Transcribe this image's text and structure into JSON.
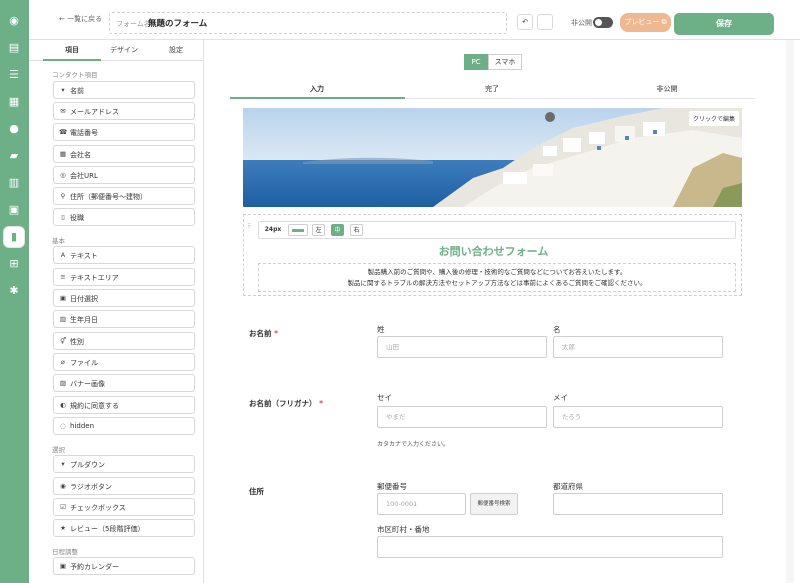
{
  "topbar": {
    "back_label": "← 一覧に戻る",
    "form_name_label": "フォーム名",
    "form_name_value": "無題のフォーム",
    "publish_label": "非公開",
    "preview_label": "プレビュー ⧉",
    "save_label": "保存"
  },
  "panel": {
    "tabs": [
      "項目",
      "デザイン",
      "設定"
    ],
    "sections": {
      "contact": "コンタクト項目",
      "basic": "基本",
      "choice": "選択",
      "schedule": "日程調整"
    },
    "contact_items": [
      "名前",
      "メールアドレス",
      "電話番号",
      "会社名",
      "会社URL",
      "住所（郵便番号〜建物）",
      "役職"
    ],
    "basic_items": [
      "テキスト",
      "テキストエリア",
      "日付選択",
      "生年月日",
      "性別",
      "ファイル",
      "バナー画像",
      "規約に同意する",
      "hidden"
    ],
    "choice_items": [
      "プルダウン",
      "ラジオボタン",
      "チェックボックス",
      "レビュー（5段階評価）"
    ],
    "schedule_items": [
      "予約カレンダー"
    ]
  },
  "canvas": {
    "device": {
      "pc": "PC",
      "sp": "スマホ"
    },
    "page_tabs": [
      "入力",
      "完了",
      "非公開"
    ],
    "hero_edit_label": "クリックで編集",
    "toolbar": {
      "size": "24px",
      "left": "左",
      "center": "中",
      "right": "右"
    },
    "form_title": "お問い合わせフォーム",
    "description_line1": "製品購入前のご質問や、購入後の修理・技術的なご質問などについてお答えいたします。",
    "description_line2": "製品に関するトラブルの解決方法やセットアップ方法などは事前によくあるご質問をご確認ください。",
    "fields": {
      "name": {
        "label": "お名前",
        "last_label": "姓",
        "last_placeholder": "山田",
        "first_label": "名",
        "first_placeholder": "太郎"
      },
      "kana": {
        "label": "お名前（フリガナ）",
        "last_label": "セイ",
        "last_placeholder": "やまだ",
        "first_label": "メイ",
        "first_placeholder": "たろう",
        "hint": "カタカナで入力ください。"
      },
      "address": {
        "label": "住所",
        "zip_label": "郵便番号",
        "zip_placeholder": "100-0001",
        "zip_button": "郵便番号検索",
        "pref_label": "都道府県",
        "city_label": "市区町村・番地"
      }
    },
    "required_mark": "*"
  },
  "colors": {
    "accent": "#6db088",
    "preview": "#f0b890",
    "required": "#e05050"
  },
  "icons": [
    "palette-icon",
    "clipboard-icon",
    "list-icon",
    "building-icon",
    "users-icon",
    "folder-icon",
    "calculator-icon",
    "calendar-icon",
    "document-icon",
    "sitemap-icon",
    "gear-icon"
  ]
}
